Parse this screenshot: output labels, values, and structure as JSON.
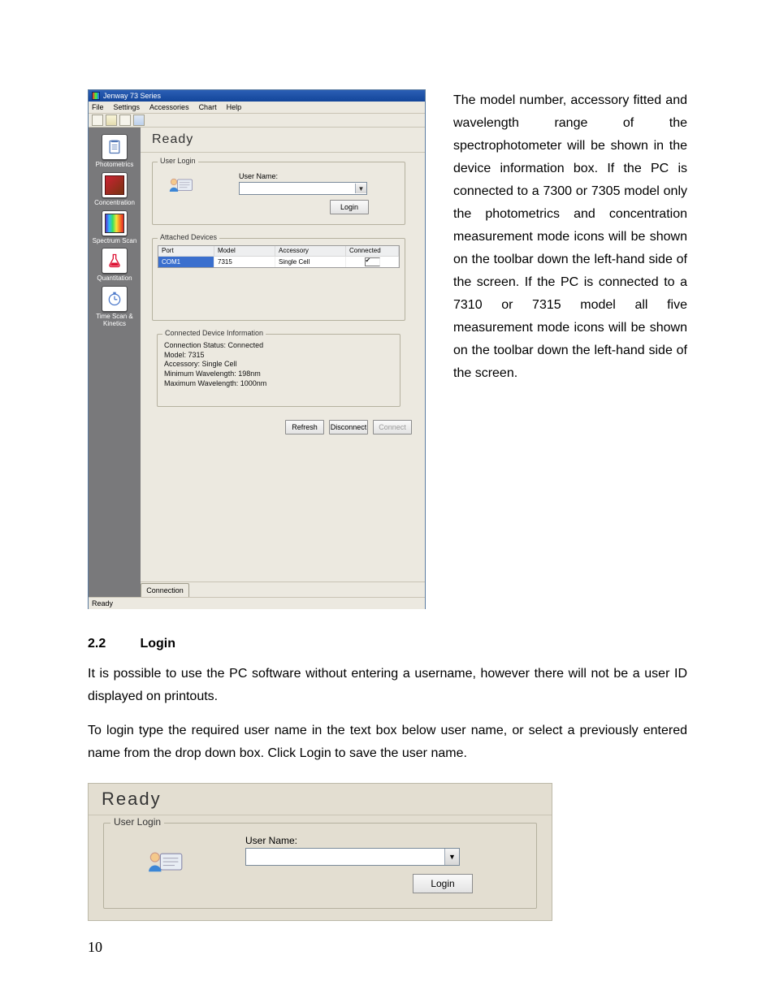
{
  "screenshot1": {
    "window_title": "Jenway 73 Series",
    "menus": {
      "file": "File",
      "settings": "Settings",
      "accessories": "Accessories",
      "chart": "Chart",
      "help": "Help"
    },
    "sidebar": {
      "items": [
        {
          "label": "Photometrics"
        },
        {
          "label": "Concentration"
        },
        {
          "label": "Spectrum Scan"
        },
        {
          "label": "Quantitation"
        },
        {
          "label": "Time Scan & Kinetics"
        }
      ]
    },
    "ready_label": "Ready",
    "user_login": {
      "group_caption": "User Login",
      "username_label": "User Name:",
      "username_value": "",
      "login_button": "Login"
    },
    "attached_devices": {
      "group_caption": "Attached Devices",
      "headers": {
        "port": "Port",
        "model": "Model",
        "accessory": "Accessory",
        "connected": "Connected"
      },
      "rows": [
        {
          "port": "COM1",
          "model": "7315",
          "accessory": "Single Cell",
          "connected": true
        }
      ]
    },
    "device_info": {
      "group_caption": "Connected Device Information",
      "lines": {
        "l1": "Connection Status: Connected",
        "l2": "Model: 7315",
        "l3": "Accessory: Single Cell",
        "l4": "Minimum Wavelength: 198nm",
        "l5": "Maximum Wavelength: 1000nm"
      }
    },
    "buttons": {
      "refresh": "Refresh",
      "disconnect": "Disconnect",
      "connect": "Connect"
    },
    "tab_label": "Connection",
    "status_text": "Ready"
  },
  "right_paragraph": "The model number, accessory fitted and wavelength range of the spectrophotometer will be shown in the device information box. If the PC is connected to a 7300 or 7305 model only the photometrics and concentration measurement mode icons will be shown on the toolbar down the left-hand side of the screen. If the PC is connected to a 7310 or 7315 model all five measurement mode icons will be shown on the toolbar down the left-hand side of the screen.",
  "section": {
    "number": "2.2",
    "title": "Login",
    "para1": "It is possible to use the PC software without entering a username, however there will not be a user ID displayed on printouts.",
    "para2": "To login type the required user name in the text box below user name, or select a previously entered name from the drop down box. Click Login to save the user name."
  },
  "screenshot2": {
    "ready_label": "Ready",
    "group_caption": "User Login",
    "username_label": "User Name:",
    "username_value": "",
    "login_button": "Login"
  },
  "page_number": "10"
}
